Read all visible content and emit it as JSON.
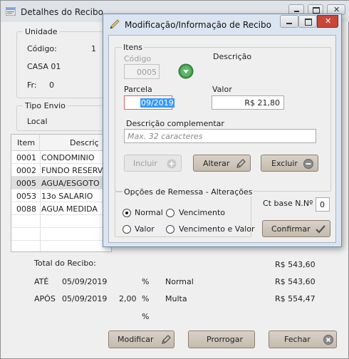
{
  "back_window": {
    "title": "Detalhes do Recibo",
    "unidade": {
      "legend": "Unidade",
      "codigo_label": "Código:",
      "codigo_value": "1",
      "name": "CASA 01",
      "fr_label": "Fr:",
      "fr_value": "0"
    },
    "tipo_envio": {
      "legend": "Tipo Envio",
      "value": "Local"
    },
    "grid": {
      "headers": [
        "Item",
        "Descriç"
      ],
      "rows": [
        {
          "item": "0001",
          "desc": "CONDOMINIO"
        },
        {
          "item": "0002",
          "desc": "FUNDO RESERVA"
        },
        {
          "item": "0005",
          "desc": "AGUA/ESGOTO"
        },
        {
          "item": "0053",
          "desc": "13o SALARIO"
        },
        {
          "item": "0088",
          "desc": "AGUA MEDIDA"
        }
      ],
      "selected_row": 2
    },
    "totals": {
      "total_label": "Total do Recibo:",
      "total_value": "R$ 543,60",
      "ate_label": "ATÉ",
      "ate_date": "05/09/2019",
      "ate_pct": "%",
      "ate_type": "Normal",
      "ate_value": "R$ 543,60",
      "apos_label": "APÓS",
      "apos_date": "05/09/2019",
      "apos_rate": "2,00",
      "apos_pct": "%",
      "apos_type": "Multa",
      "apos_value": "R$ 554,47",
      "extra_pct": "%"
    },
    "buttons": {
      "modificar": "Modificar",
      "prorrogar": "Prorrogar",
      "fechar": "Fechar"
    }
  },
  "modal": {
    "title": "Modificação/Informação de Recibo",
    "itens": {
      "legend": "Itens",
      "codigo_label": "Código",
      "codigo_value": "0005",
      "descricao_label": "Descrição",
      "parcela_label": "Parcela",
      "parcela_value": "09/2019",
      "valor_label": "Valor",
      "valor_value": "R$ 21,80",
      "desc_comp_label": "Descrição complementar",
      "desc_comp_placeholder": "Max. 32 caracteres",
      "incluir": "Incluir",
      "alterar": "Alterar",
      "excluir": "Excluir"
    },
    "remessa": {
      "legend": "Opções de Remessa - Alterações",
      "options": [
        "Normal",
        "Vencimento",
        "Valor",
        "Vencimento e Valor"
      ],
      "selected": "Normal"
    },
    "ct_base_label": "Ct base N.Nº",
    "ct_base_value": "0",
    "confirmar": "Confirmar"
  },
  "colors": {
    "accent_red": "#e81123",
    "selection_blue": "#3399ff",
    "button_face": "#cfc7ba"
  }
}
